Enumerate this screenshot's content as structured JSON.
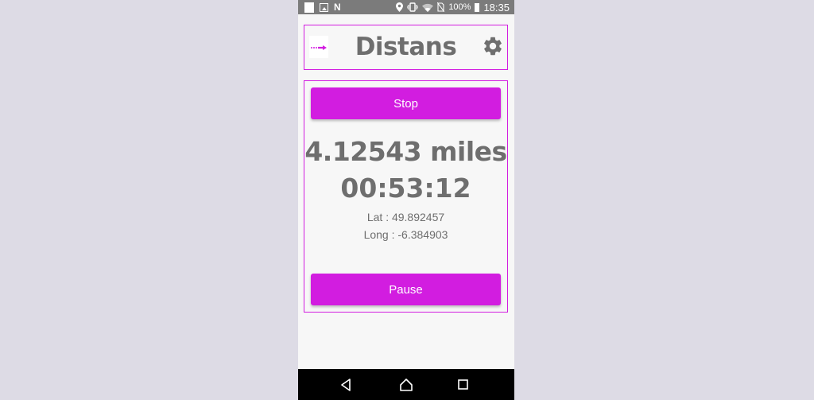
{
  "status_bar": {
    "battery_percent": "100%",
    "time": "18:35",
    "icons": [
      "notification-square-icon",
      "image-icon",
      "n-app-icon",
      "location-icon",
      "vibrate-icon",
      "wifi-icon",
      "no-sim-icon",
      "battery-icon"
    ]
  },
  "header": {
    "title": "Distans",
    "logo_icon": "arrow-logo-icon",
    "settings_icon": "gear-icon"
  },
  "tracker": {
    "stop_label": "Stop",
    "distance": "4.12543 miles",
    "elapsed": "00:53:12",
    "latitude": "Lat : 49.892457",
    "longitude": "Long : -6.384903",
    "pause_label": "Pause"
  },
  "nav_bar": {
    "buttons": [
      "back-icon",
      "home-icon",
      "recents-icon"
    ]
  },
  "colors": {
    "accent": "#d21de0",
    "text": "#6e6e6e",
    "background": "#f7f7f7",
    "page_background": "#dddbe5",
    "status_bar": "#7b7b7b",
    "nav_bar": "#000000"
  }
}
